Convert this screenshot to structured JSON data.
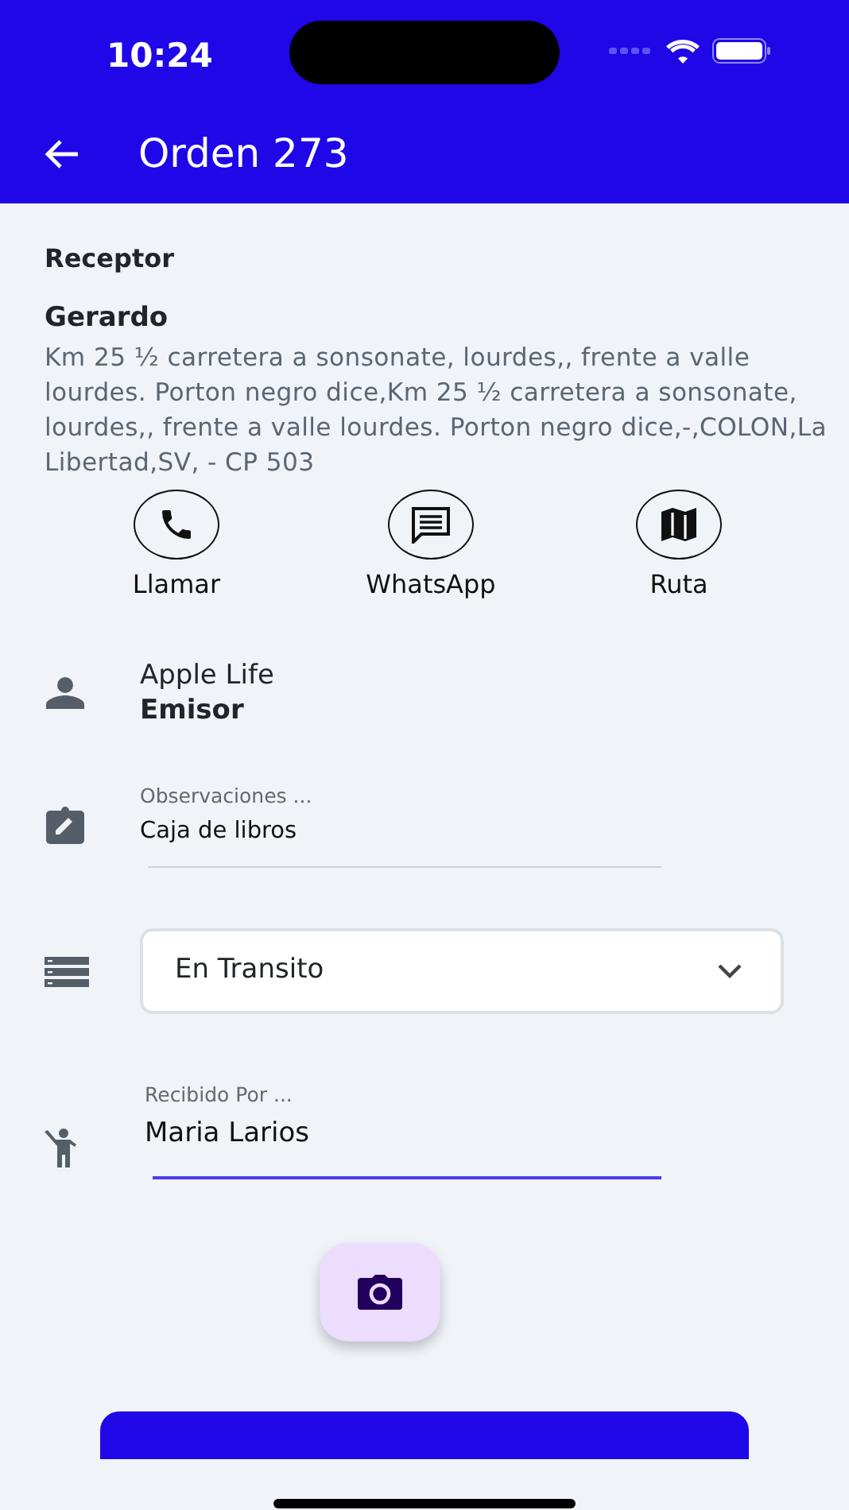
{
  "status_bar": {
    "time": "10:24"
  },
  "app_bar": {
    "title": "Orden 273"
  },
  "receiver": {
    "heading": "Receptor",
    "name": "Gerardo",
    "address": "Km 25 ¹⁄₂ carretera a sonsonate, lourdes,, frente a valle lourdes. Porton negro dice,Km 25 ¹⁄₂ carretera a sonsonate, lourdes,, frente a valle lourdes. Porton negro dice,-,COLON,La Libertad,SV, - CP 503"
  },
  "actions": [
    {
      "kind": "call",
      "label": "Llamar"
    },
    {
      "kind": "message",
      "label": "WhatsApp"
    },
    {
      "kind": "map",
      "label": "Ruta"
    }
  ],
  "sender": {
    "name": "Apple Life",
    "label": "Emisor"
  },
  "observations": {
    "label": "Observaciones ...",
    "value": "Caja de libros",
    "focused": false
  },
  "status_select": {
    "value": "En Transito"
  },
  "received_by": {
    "label": "Recibido Por ...",
    "value": "Maria Larios",
    "focused": true
  }
}
